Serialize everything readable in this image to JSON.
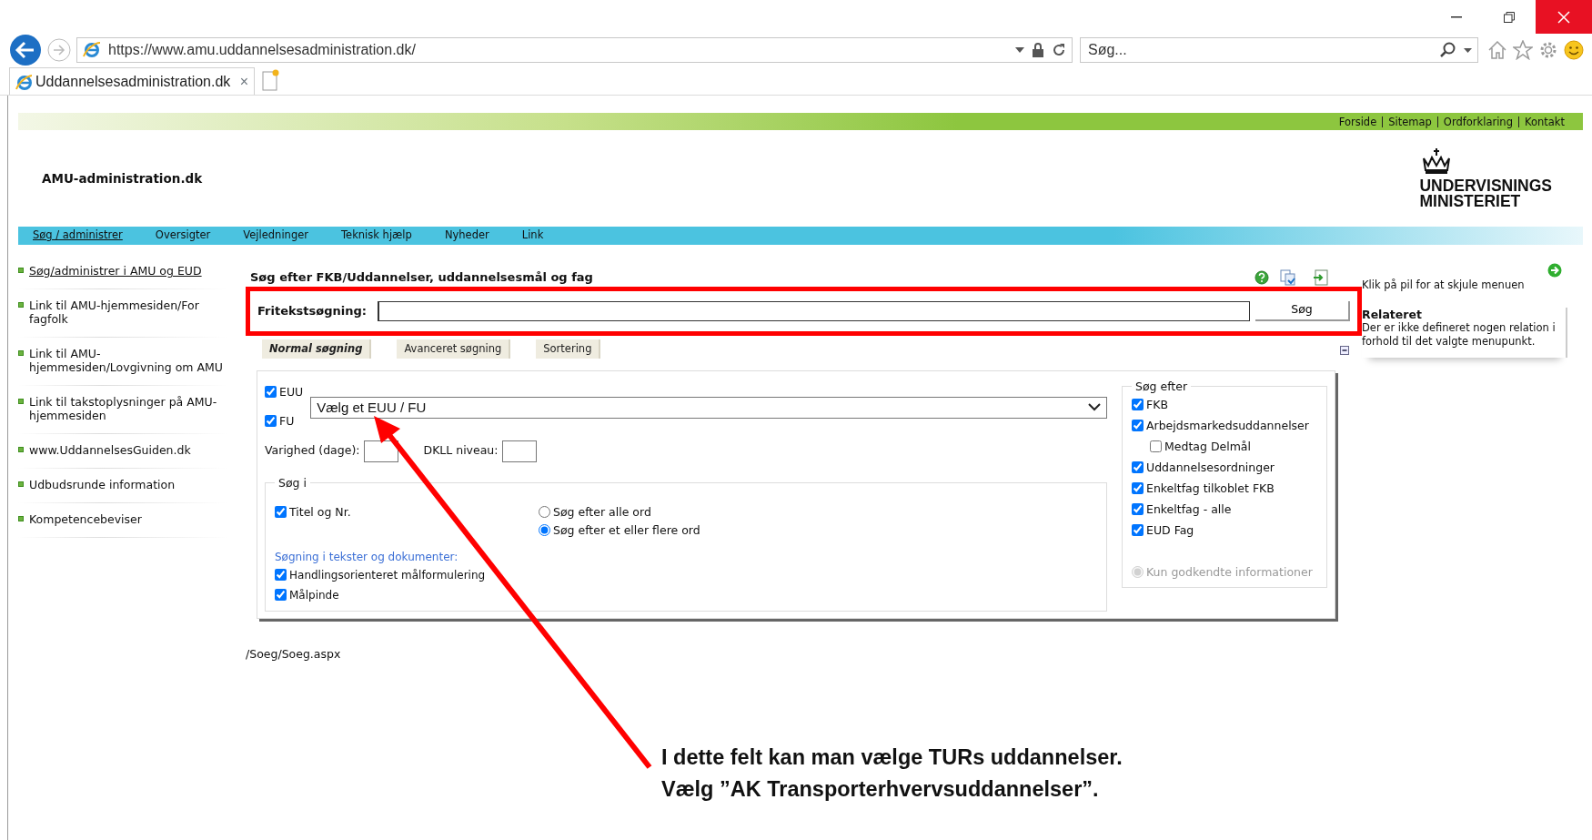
{
  "browser": {
    "address": "https://www.amu.uddannelsesadministration.dk/",
    "search_placeholder": "Søg...",
    "tab_title": "Uddannelsesadministration.dk",
    "tab_close": "×"
  },
  "top_links": [
    "Forside",
    "Sitemap",
    "Ordforklaring",
    "Kontakt"
  ],
  "site_title": "AMU-administration.dk",
  "ministry_logo": {
    "lines": [
      "UNDERVISNINGS",
      "MINISTERIET"
    ]
  },
  "nav": [
    {
      "label": "Søg / administrer",
      "selected": true
    },
    {
      "label": "Oversigter",
      "selected": false
    },
    {
      "label": "Vejledninger",
      "selected": false
    },
    {
      "label": "Teknisk hjælp",
      "selected": false
    },
    {
      "label": "Nyheder",
      "selected": false
    },
    {
      "label": "Link",
      "selected": false
    }
  ],
  "sidebar": {
    "items": [
      {
        "label": "Søg/administrer i AMU og EUD",
        "selected": true
      },
      {
        "label": "Link til AMU-hjemmesiden/For fagfolk",
        "selected": false
      },
      {
        "label": "Link til AMU-hjemmesiden/Lovgivning om AMU",
        "selected": false
      },
      {
        "label": "Link til takstoplysninger på AMU-hjemmesiden",
        "selected": false
      },
      {
        "label": "www.UddannelsesGuiden.dk",
        "selected": false
      },
      {
        "label": "Udbudsrunde information",
        "selected": false
      },
      {
        "label": "Kompetencebeviser",
        "selected": false
      }
    ]
  },
  "search": {
    "title": "Søg efter FKB/Uddannelser, uddannelsesmål og fag",
    "label": "Fritekstsøgning:",
    "button": "Søg"
  },
  "tabs": [
    {
      "label": "Normal søgning",
      "selected": true
    },
    {
      "label": "Avanceret søgning",
      "selected": false
    },
    {
      "label": "Sortering",
      "selected": false
    }
  ],
  "form": {
    "types": [
      {
        "label": "EUU",
        "checked": true
      },
      {
        "label": "FU",
        "checked": true
      }
    ],
    "select": {
      "value": "Vælg et EUU / FU"
    },
    "duration": {
      "label": "Varighed (dage):"
    },
    "level_field": {
      "label": "DKLL niveau:"
    },
    "search_in": {
      "legend": "Søg i",
      "options": [
        {
          "label": "Titel og Nr.",
          "checked": true
        }
      ],
      "modes": [
        {
          "label": "Søg efter alle ord",
          "selected": false
        },
        {
          "label": "Søg efter et eller flere ord",
          "selected": true
        }
      ],
      "texts_heading": "Søgning i tekster og dokumenter:",
      "text_options": [
        {
          "label": "Handlingsorienteret målformulering",
          "checked": true
        },
        {
          "label": "Målpinde",
          "checked": true
        }
      ]
    },
    "search_for": {
      "legend": "Søg efter",
      "options": [
        {
          "label": "FKB",
          "checked": true
        },
        {
          "label": "Arbejdsmarkedsuddannelser",
          "checked": true,
          "children": [
            {
              "label": "Medtag Delmål",
              "checked": false
            }
          ]
        },
        {
          "label": "Uddannelsesordninger",
          "checked": true
        },
        {
          "label": "Enkeltfag tilkoblet FKB",
          "checked": true
        },
        {
          "label": "Enkeltfag - alle",
          "checked": true
        },
        {
          "label": "EUD Fag",
          "checked": true
        }
      ],
      "approved": {
        "label": "Kun godkendte informationer",
        "selected": true,
        "disabled": true
      }
    }
  },
  "related": {
    "hint": "Klik på pil for at skjule menuen",
    "title": "Relateret",
    "text": "Der er ikke defineret nogen relation i forhold til det valgte menupunkt."
  },
  "path": "/Soeg/Soeg.aspx",
  "annotation": {
    "lines": [
      "I dette felt kan man vælge TURs uddannelser.",
      "Vælg ”AK Transporterhvervsuddannelser”."
    ]
  }
}
